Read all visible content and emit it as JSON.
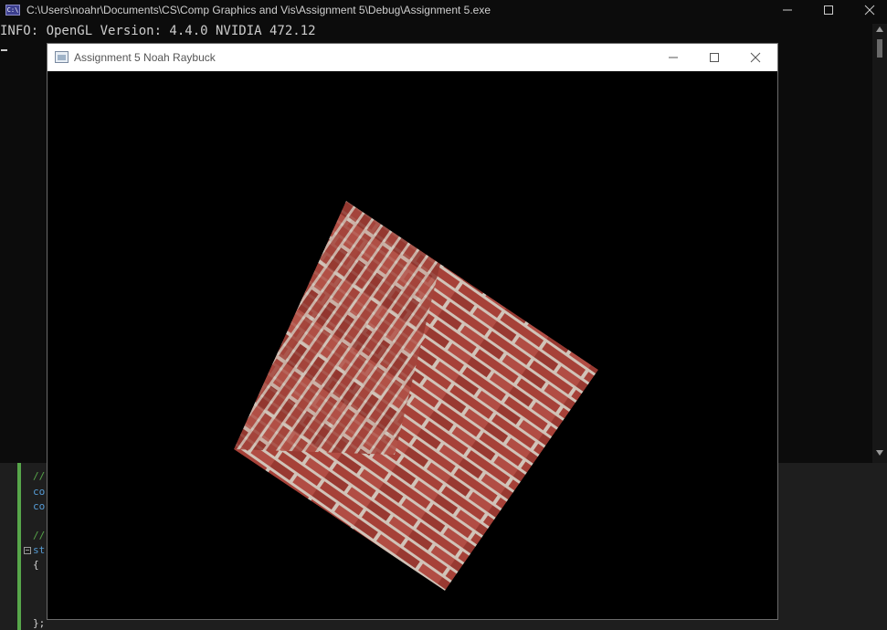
{
  "console": {
    "title": "C:\\Users\\noahr\\Documents\\CS\\Comp Graphics and Vis\\Assignment 5\\Debug\\Assignment 5.exe",
    "icon_label": "C:\\",
    "output_line": "INFO: OpenGL Version: 4.4.0 NVIDIA 472.12"
  },
  "ide": {
    "lines": [
      {
        "text": "//",
        "kind": "comment"
      },
      {
        "text": "co",
        "kind": "kw"
      },
      {
        "text": "co",
        "kind": "kw"
      },
      {
        "text": "//",
        "kind": "comment"
      },
      {
        "text": "st",
        "kind": "kw"
      },
      {
        "text": "{",
        "kind": "punct"
      },
      {
        "text": "};",
        "kind": "punct"
      }
    ],
    "collapse_glyph": "−"
  },
  "gl_window": {
    "title": "Assignment 5 Noah Raybuck",
    "quad_texture": "red brick herringbone corner pattern",
    "quad_rotation_deg": 35
  },
  "colors": {
    "console_bg": "#0c0c0c",
    "console_text": "#cccccc",
    "ide_bg": "#1e1e1e",
    "ide_change_bar": "#57a64a",
    "gl_title_bg": "#ffffff",
    "brick": "#b5473d",
    "mortar": "#e3d4c8"
  },
  "icons": {
    "minimize": "minimize-icon",
    "maximize": "maximize-icon",
    "close": "close-icon"
  }
}
